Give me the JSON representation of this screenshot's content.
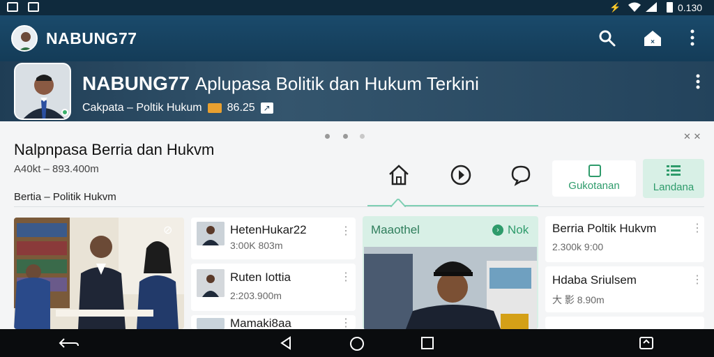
{
  "status": {
    "time": "0.130"
  },
  "app_bar": {
    "title": "NABUNG77"
  },
  "hero": {
    "title_brand": "NABUNG77",
    "title_rest": "Aplupasa Bolitik dan Hukum Terkini",
    "subtitle": "Cakpata – Poltik Hukum",
    "badge_value": "86.25"
  },
  "headline": {
    "title": "Nalpnpasa Berria dan Hukvm",
    "meta": "A40kt – 893.400m",
    "category": "Bertia – Politik Hukvm"
  },
  "nav_tabs": {
    "guard_label": "Gukotanan",
    "landing_label": "Landana"
  },
  "list_items": [
    {
      "title": "HetenHukar22",
      "sub": "3:00K 803m"
    },
    {
      "title": "Ruten Iottia",
      "sub": "2:203.900m"
    },
    {
      "title": "Mamaki8aa",
      "sub": ""
    }
  ],
  "featured": {
    "label": "Maaothel",
    "badge": "Nok"
  },
  "right_list": [
    {
      "title_bold": "Berria",
      "title_rest": "Poltik Hukvm",
      "sub": "2.300k 9:00"
    },
    {
      "title": "Hdaba Sriulsem",
      "sub": "大 影 8.90m"
    }
  ],
  "icons": {
    "search": "search-icon",
    "home": "home-icon",
    "more": "more-vertical-icon"
  },
  "colors": {
    "app_bar": "#1a4a6b",
    "accent_green": "#2e9b6b",
    "accent_mint": "#d8f0e6"
  }
}
